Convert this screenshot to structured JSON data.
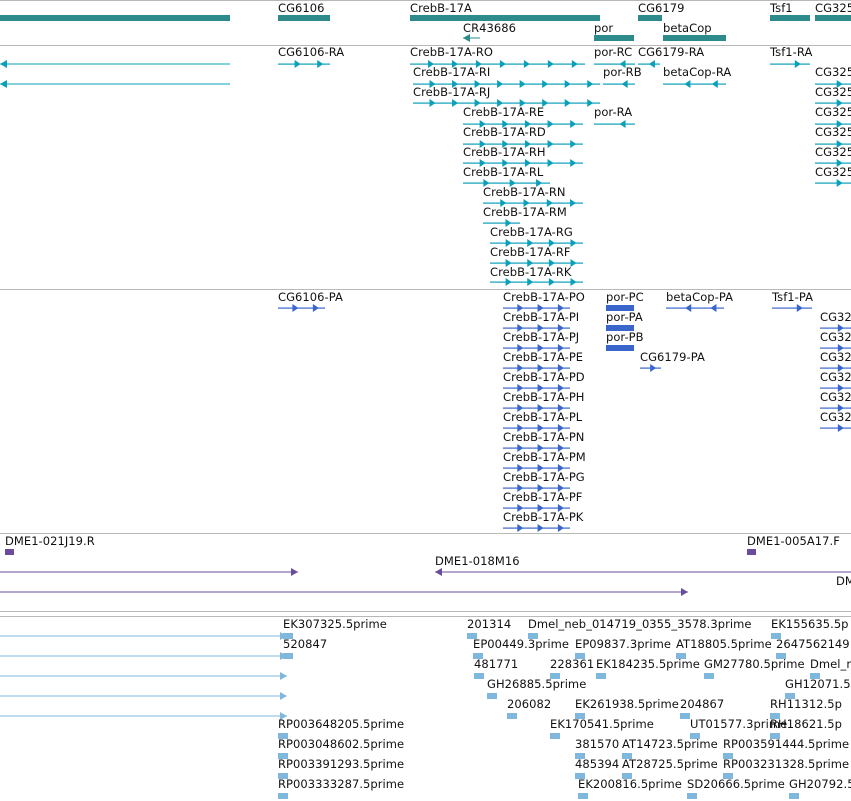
{
  "colors": {
    "gene": "#2e8b8b",
    "mrna": "#0aa0b8",
    "protein": "#3a66cc",
    "bac": "#6a4c9c",
    "est": "#7fb8dc",
    "divider": "#b8b8b8"
  },
  "tracks": {
    "genes": [
      "CG6106",
      "CrebB-17A",
      "CR43686",
      "por",
      "CG6179",
      "betaCop",
      "Tsf1",
      "CG325"
    ],
    "transcripts": [
      "CG6106-RA",
      "CrebB-17A-RO",
      "CrebB-17A-RI",
      "CrebB-17A-RJ",
      "CrebB-17A-RE",
      "CrebB-17A-RD",
      "CrebB-17A-RH",
      "CrebB-17A-RL",
      "CrebB-17A-RN",
      "CrebB-17A-RM",
      "CrebB-17A-RG",
      "CrebB-17A-RF",
      "CrebB-17A-RK",
      "por-RC",
      "CG6179-RA",
      "por-RB",
      "betaCop-RA",
      "por-RA",
      "Tsf1-RA",
      "CG325",
      "CG325",
      "CG325",
      "CG325",
      "CG325",
      "CG325"
    ],
    "proteins": [
      "CG6106-PA",
      "CrebB-17A-PO",
      "CrebB-17A-PI",
      "CrebB-17A-PJ",
      "CrebB-17A-PE",
      "CrebB-17A-PD",
      "CrebB-17A-PH",
      "CrebB-17A-PL",
      "CrebB-17A-PN",
      "CrebB-17A-PM",
      "CrebB-17A-PG",
      "CrebB-17A-PF",
      "CrebB-17A-PK",
      "por-PC",
      "por-PA",
      "por-PB",
      "CG6179-PA",
      "betaCop-PA",
      "Tsf1-PA",
      "CG32",
      "CG32",
      "CG32",
      "CG32",
      "CG32",
      "CG32"
    ],
    "bac_clones": [
      "DME1-021J19.R",
      "DME1-018M16",
      "DME1-005A17.F",
      "DM"
    ],
    "ests": [
      "EK307325.5prime",
      "520847",
      "201314",
      "Dmel_neb_014719_0355_3578.3prime",
      "EK155635.5p",
      "EP00449.3prime",
      "EP09837.3prime",
      "AT18805.5prime",
      "2647562149",
      "481771",
      "228361",
      "EK184235.5prime",
      "GM27780.5prime",
      "Dmel_n",
      "GH26885.5prime",
      "GH12071.5",
      "206082",
      "EK261938.5prime",
      "204867",
      "RH11312.5p",
      "RP003648205.5prime",
      "EK170541.5prime",
      "UT01577.3prime",
      "RH18621.5p",
      "RP003048602.5prime",
      "381570",
      "AT14723.5prime",
      "RP003591444.5prime",
      "RP003391293.5prime",
      "485394",
      "AT28725.5prime",
      "RP003231328.5prime",
      "RP003333287.5prime",
      "EK200816.5prime",
      "SD20666.5prime",
      "GH20792.5"
    ]
  }
}
